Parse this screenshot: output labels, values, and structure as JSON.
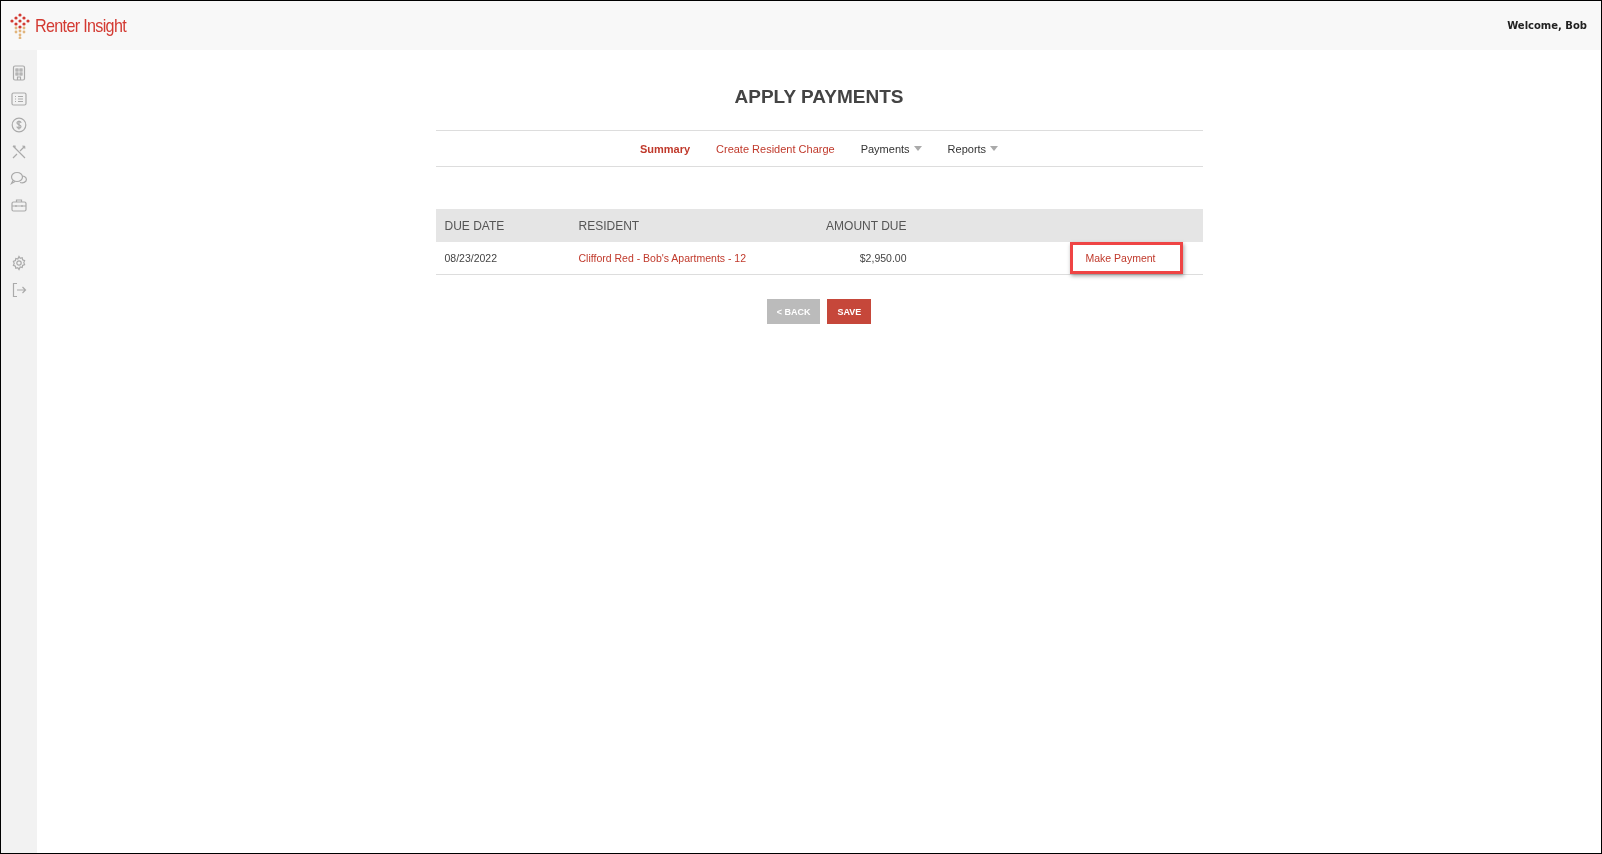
{
  "header": {
    "brand": "Renter Insight",
    "welcome": "Welcome, Bob"
  },
  "page_title": "APPLY PAYMENTS",
  "tabs": [
    {
      "label": "Summary",
      "kind": "link",
      "selected": true
    },
    {
      "label": "Create Resident Charge",
      "kind": "link",
      "selected": false
    },
    {
      "label": "Payments",
      "kind": "dropdown",
      "selected": false
    },
    {
      "label": "Reports",
      "kind": "dropdown",
      "selected": false
    }
  ],
  "table": {
    "columns": [
      "DUE DATE",
      "RESIDENT",
      "AMOUNT DUE"
    ],
    "rows": [
      {
        "due_date": "08/23/2022",
        "resident": "Clifford Red - Bob's Apartments - 12",
        "amount_due": "$2,950.00",
        "action": "Make Payment",
        "highlighted": true
      }
    ]
  },
  "buttons": [
    {
      "label": "< BACK",
      "kind": "secondary"
    },
    {
      "label": "SAVE",
      "kind": "primary"
    }
  ]
}
